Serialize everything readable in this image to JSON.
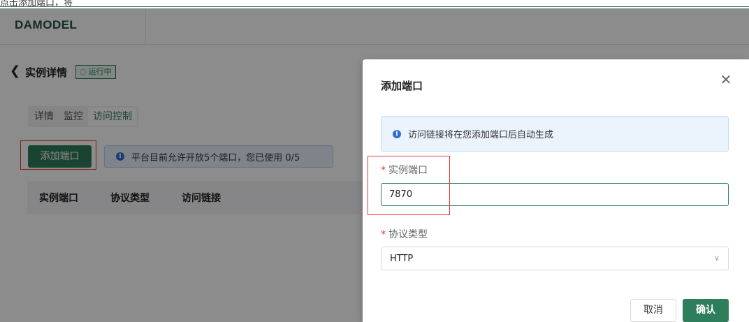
{
  "top_strip": {
    "fragment_text": "点击添加端口，将"
  },
  "header": {
    "logo": "DAMODEL"
  },
  "page": {
    "title": "实例详情",
    "status": "运行中",
    "tabs": [
      {
        "label": "详情",
        "active": false
      },
      {
        "label": "监控",
        "active": false
      },
      {
        "label": "访问控制",
        "active": true
      }
    ],
    "add_port_label": "添加端口",
    "port_notice": "平台目前允许开放5个端口，您已使用 0/5",
    "table_headers": [
      "实例端口",
      "协议类型",
      "访问链接"
    ]
  },
  "dialog": {
    "title": "添加端口",
    "notice": "访问链接将在您添加端口后自动生成",
    "port_label": "实例端口",
    "port_value": "7870",
    "protocol_label": "协议类型",
    "protocol_value": "HTTP",
    "cancel_label": "取消",
    "confirm_label": "确认",
    "required_mark": "*"
  },
  "colors": {
    "accent": "#2e7d5b",
    "highlight": "#e53935",
    "info": "#2e6fd1"
  },
  "icons": [
    "back-arrow-icon",
    "spinner-icon",
    "info-icon",
    "close-icon",
    "chevron-down-icon"
  ]
}
